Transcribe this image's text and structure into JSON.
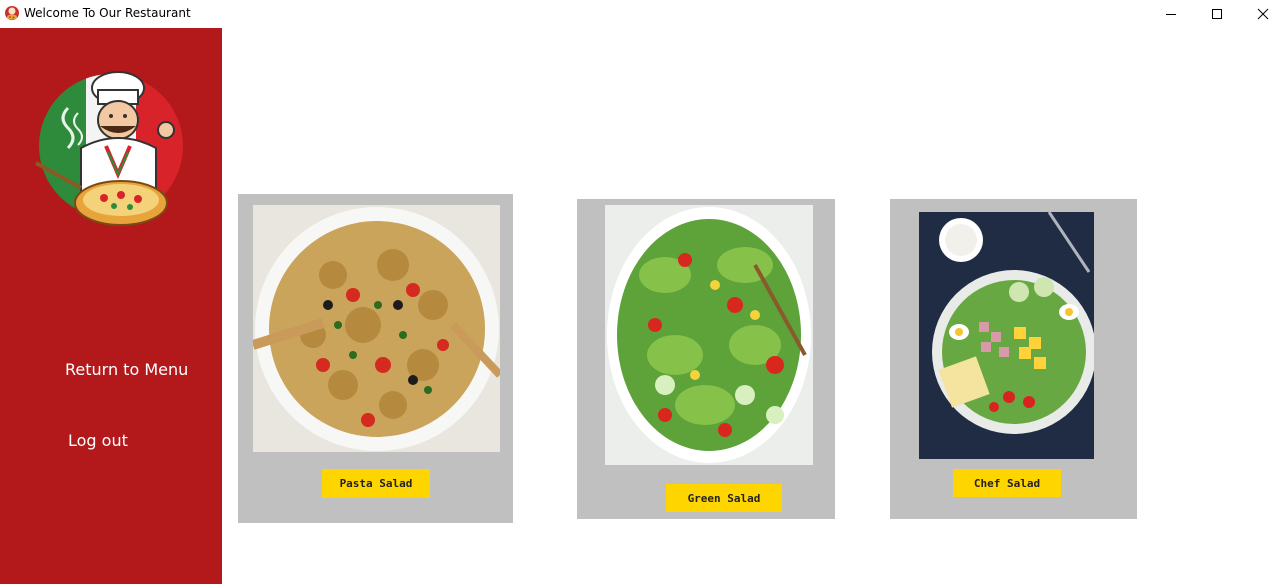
{
  "window": {
    "title": "Welcome To Our Restaurant",
    "icon": "pizza-chef-icon"
  },
  "sidebar": {
    "logo": "pizza-chef-logo",
    "return_label": "Return to Menu",
    "logout_label": "Log out",
    "color": "#b3191b"
  },
  "items": [
    {
      "label": "Pasta Salad",
      "image": "pasta-salad-photo"
    },
    {
      "label": "Green Salad",
      "image": "green-salad-photo"
    },
    {
      "label": "Chef Salad",
      "image": "chef-salad-photo"
    }
  ],
  "colors": {
    "button": "#ffd500",
    "card": "#c0c0c0"
  }
}
